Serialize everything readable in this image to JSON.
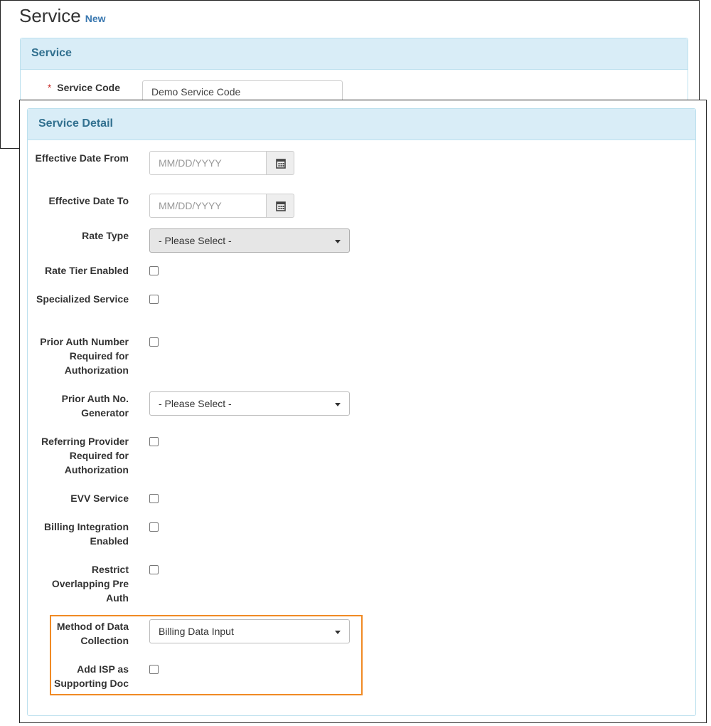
{
  "page": {
    "title": "Service",
    "subtitle": "New"
  },
  "service_panel": {
    "heading": "Service",
    "service_code": {
      "label": "Service Code",
      "required_mark": "*",
      "value": "Demo Service Code"
    }
  },
  "detail_panel": {
    "heading": "Service Detail",
    "effective_from": {
      "label": "Effective Date From",
      "placeholder": "MM/DD/YYYY"
    },
    "effective_to": {
      "label": "Effective Date To",
      "placeholder": "MM/DD/YYYY"
    },
    "rate_type": {
      "label": "Rate Type",
      "value": "- Please Select -"
    },
    "rate_tier": {
      "label": "Rate Tier Enabled",
      "checked": false
    },
    "specialized": {
      "label": "Specialized Service",
      "checked": false
    },
    "prior_auth_required": {
      "label": "Prior Auth Number Required for Authorization",
      "checked": false
    },
    "prior_auth_generator": {
      "label": "Prior Auth No. Generator",
      "value": "- Please Select -"
    },
    "referring_provider": {
      "label": "Referring Provider Required for Authorization",
      "checked": false
    },
    "evv": {
      "label": "EVV Service",
      "checked": false
    },
    "billing_integration": {
      "label": "Billing Integration Enabled",
      "checked": false
    },
    "restrict_overlap": {
      "label": "Restrict Overlapping Pre Auth",
      "checked": false
    },
    "method_collection": {
      "label": "Method of Data Collection",
      "value": "Billing Data Input"
    },
    "add_isp": {
      "label": "Add ISP as Supporting Doc",
      "checked": false
    }
  },
  "colors": {
    "panel_header": "#d9edf7",
    "panel_title": "#31708f",
    "highlight": "#f08a24",
    "link": "#3a78b0"
  },
  "icons": {
    "date_button": "calendar-icon",
    "select_caret": "caret-down-icon"
  }
}
